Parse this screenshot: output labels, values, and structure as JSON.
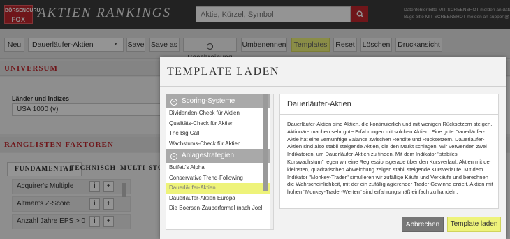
{
  "header": {
    "logo_line1": "BÖRSENGURU",
    "logo_line2": "FOX",
    "title": "AKTIEN RANKINGS",
    "search_placeholder": "Aktie, Kürzel, Symbol",
    "note_line1": "Datenfehler bitte MIT SCREENSHOT melden an data@",
    "note_line2": "Bugs bitte MIT SCREENSHOT melden an support@"
  },
  "toolbar": {
    "new": "Neu",
    "ranking_select": "Dauerläufer-Aktien",
    "save": "Save",
    "save_as": "Save as",
    "describe": "Beschreibung",
    "rename": "Umbenennen",
    "templates": "Templates",
    "reset": "Reset",
    "delete": "Löschen",
    "print": "Druckansicht"
  },
  "universe": {
    "heading": "UNIVERSUM",
    "label": "Länder und Indizes",
    "value": "USA 1000 (v)"
  },
  "factors": {
    "heading": "RANGLISTEN-FAKTOREN",
    "tabs": [
      "FUNDAMENTAL",
      "TECHNISCH",
      "MULTI-STOC"
    ],
    "items": [
      "Acquirer's Multiple",
      "Altman's Z-Score",
      "Anzahl Jahre EPS > 0"
    ],
    "info": "i",
    "add": "+"
  },
  "modal": {
    "title": "TEMPLATE LADEN",
    "groups": [
      {
        "name": "Scoring-Systeme",
        "items": [
          "Dividenden-Check für Aktien",
          "Qualitäts-Check für Aktien",
          "The Big Call",
          "Wachstums-Check für Aktien"
        ]
      },
      {
        "name": "Anlagestrategien",
        "items": [
          "Buffett's Alpha",
          "Conservative Trend-Following",
          "Dauerläufer-Aktien",
          "Dauerläufer-Aktien Europa",
          "Die Boersen-Zauberformel (nach Joel"
        ]
      }
    ],
    "desc_title": "Dauerläufer-Aktien",
    "desc_text": "Dauerläufer-Aktien sind Aktien, die kontinuierlich und mit wenigen Rücksetzern steigen. Aktionäre machen sehr gute Erfahrungen mit solchen Aktien. Eine gute Dauerläufer-Aktie hat eine vernünftige Balance zwischen Rendite und Rücksetzern. Dauerläufer-Aktien sind also stabil steigende Aktien, die den Markt schlagen. Wir verwenden zwei Indikatoren, um Dauerläufer-Aktien zu finden. Mit dem Indikator \"stabiles Kurswachstum\" legen wir eine Regressionsgerade über den Kursverlauf. Aktien mit der kleinsten, quadratischen Abweichung zeigen stabil steigende Kursverläufe. Mit dem Indikator \"Monkey-Trader\" simulieren wir zufällige Käufe und Verkäufe und berechnen die Wahrscheinlichkeit, mit der ein zufällig agierender Trader Gewinne erzielt. Aktien mit hohen \"Monkey-Trader-Werten\" sind erfahrungsmäß einfach zu handeln.",
    "cancel": "Abbrechen",
    "load": "Template laden"
  },
  "colors": {
    "brand_red": "#c0272d",
    "highlight_yellow": "#eef37a",
    "header_dark": "#3b3b3b"
  }
}
